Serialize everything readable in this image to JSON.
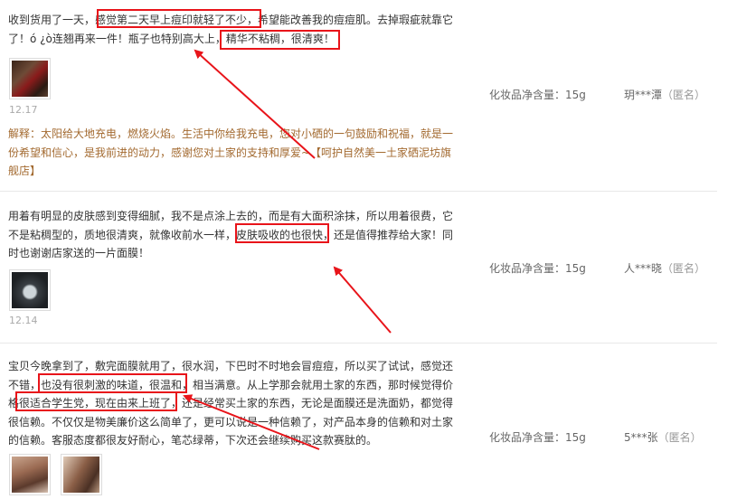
{
  "reviews": [
    {
      "text": "收到货用了一天，感觉第二天早上痘印就轻了不少，希望能改善我的痘痘肌。去掉瑕疵就靠它了！ó ¿ò连翘再来一件！瓶子也特别高大上，精华不粘稠，很清爽！",
      "date": "12.17",
      "explanation": "解释：太阳给大地充电，燃烧火焰。生活中你给我充电，您对小硒的一句鼓励和祝福，就是一份希望和信心，是我前进的动力，感谢您对土家的支持和厚爱~【呵护自然美一土家硒泥坊旗舰店】",
      "spec": "化妆品净含量：15g",
      "user": "玥***潭",
      "anon": "（匿名）"
    },
    {
      "text": "用着有明显的皮肤感到变得细腻，我不是点涂上去的，而是有大面积涂抹，所以用着很费，它不是粘稠型的，质地很清爽，就像收前水一样，皮肤吸收的也很快，还是值得推荐给大家！同时也谢谢店家送的一片面膜！",
      "date": "12.14",
      "spec": "化妆品净含量：15g",
      "user": "人***晓",
      "anon": "（匿名）"
    },
    {
      "text": "宝贝今晚拿到了，敷完面膜就用了，很水润，下巴时不时地会冒痘痘，所以买了试试，感觉还不错，也没有很刺激的味道，很温和，相当满意。从上学那会就用土家的东西，那时候觉得价格很适合学生党，现在由来上班了，还是经常买土家的东西，无论是面膜还是洗面奶，都觉得很信赖。不仅仅是物美廉价这么简单了，更可以说是一种信赖了，对产品本身的信赖和对土家的信赖。客服态度都很友好耐心，笔芯绿蒂，下次还会继续购买这款赛肽的。",
      "spec": "化妆品净含量：15g",
      "user": "5***张",
      "anon": "（匿名）"
    }
  ],
  "colors": {
    "annotation": "#e8141a",
    "explanation": "#a36a30",
    "divider": "#e8e8e8"
  }
}
